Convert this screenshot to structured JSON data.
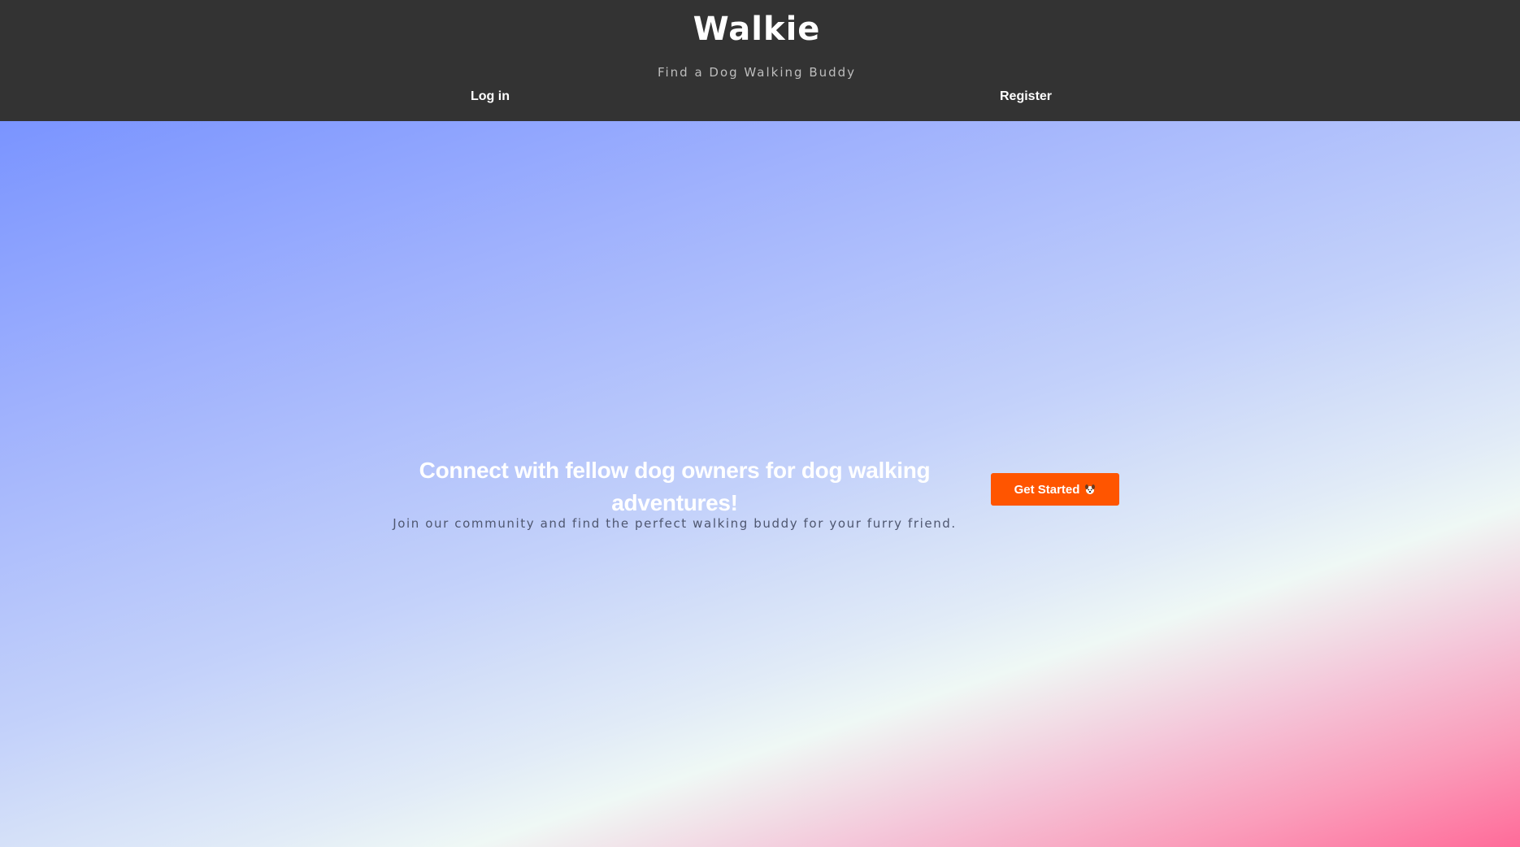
{
  "header": {
    "title": "Walkie",
    "tagline": "Find a Dog Walking Buddy",
    "nav": {
      "login_label": "Log in",
      "register_label": "Register"
    },
    "background_color": "#333333"
  },
  "hero": {
    "heading": "Connect with fellow dog owners for dog walking adventures!",
    "subheading": "Join our community and find the perfect walking buddy for your furry friend.",
    "cta": {
      "label": "Get Started",
      "icon": "dog-icon",
      "color": "#ff5500"
    },
    "gradient_colors": [
      "#7a94ff",
      "#c3d1fa",
      "#eff8f5",
      "#ff6b99"
    ]
  }
}
